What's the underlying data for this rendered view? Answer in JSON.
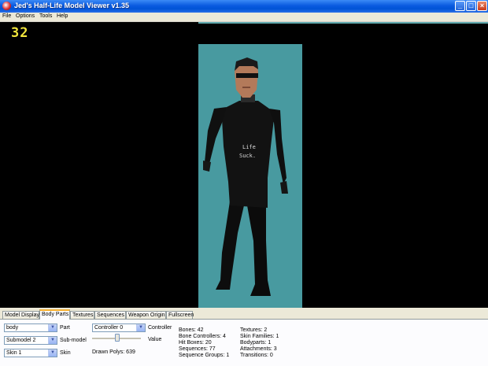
{
  "window": {
    "title": "Jed's Half-Life Model Viewer v1.35",
    "app_icon": "hl-icon"
  },
  "menu": {
    "items": [
      "File",
      "Options",
      "Tools",
      "Help"
    ]
  },
  "viewport": {
    "fps": "32",
    "model_text_1": "Life",
    "model_text_2": "Suck."
  },
  "tabs": [
    "Model Display",
    "Body Parts",
    "Textures",
    "Sequences",
    "Weapon Origin",
    "Fullscreen"
  ],
  "active_tab": "Body Parts",
  "body_parts": {
    "part_value": "body",
    "part_label": "Part",
    "submodel_value": "Submodel 2",
    "submodel_label": "Sub-model",
    "skin_value": "Skin 1",
    "skin_label": "Skin",
    "controller_value": "Controller 0",
    "controller_label": "Controller",
    "value_label": "Value",
    "drawn_polys": "Drawn Polys: 639"
  },
  "stats_col1": [
    "Bones: 42",
    "Bone Controllers: 4",
    "Hit Boxes: 20",
    "Sequences: 77",
    "Sequence Groups: 1"
  ],
  "stats_col2": [
    "Textures: 2",
    "Skin Families: 1",
    "Bodyparts: 1",
    "Attachments: 3",
    "Transitions: 0"
  ]
}
